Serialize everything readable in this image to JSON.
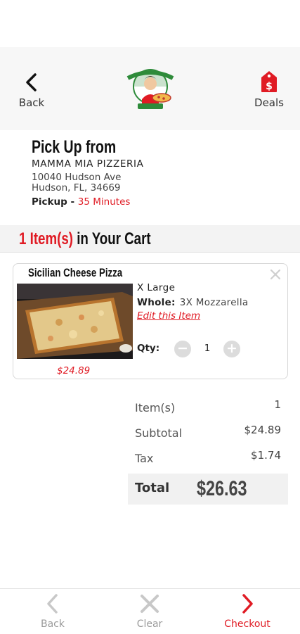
{
  "header": {
    "back_label": "Back",
    "deals_label": "Deals",
    "logo_icon": "mamma-mia-logo"
  },
  "pickup": {
    "title": "Pick Up from",
    "store_name": "MAMMA MIA PIZZERIA",
    "address_line1": "10040 Hudson Ave",
    "address_line2": "Hudson, FL, 34669",
    "label": "Pickup",
    "separator": " - ",
    "time": "35 Minutes"
  },
  "cart": {
    "count_text": "1 Item(s)",
    "heading_suffix": " in Your Cart"
  },
  "item": {
    "name": "Sicilian Cheese Pizza",
    "size": "X Large",
    "option_label": "Whole:",
    "option_value": "3X Mozzarella",
    "edit_label": "Edit this Item",
    "qty_label": "Qty:",
    "qty_value": "1",
    "price": "$24.89",
    "close_icon": "close-icon"
  },
  "summary": {
    "items_label": "Item(s)",
    "items_value": "1",
    "subtotal_label": "Subtotal",
    "subtotal_value": "$24.89",
    "tax_label": "Tax",
    "tax_value": "$1.74",
    "total_label": "Total",
    "total_value": "$26.63"
  },
  "bottom_bar": {
    "back_label": "Back",
    "clear_label": "Clear",
    "checkout_label": "Checkout"
  },
  "colors": {
    "accent": "#e01b24",
    "disabled": "#c8c8c8"
  }
}
